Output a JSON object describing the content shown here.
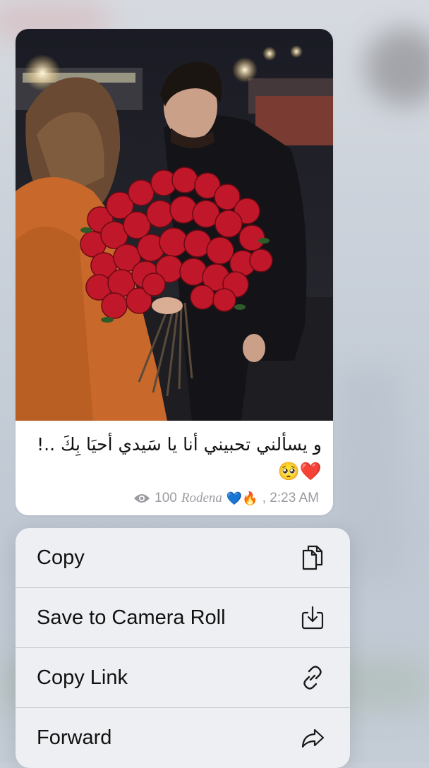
{
  "message": {
    "caption": "و يسألني تحبيني أنا يا سَيدي أحيَا بِكَ ..! ❤️🥺",
    "views": "100",
    "author": "Rodena",
    "author_emoji": "💙🔥",
    "time": ", 2:23 AM",
    "view_icon": "eye-icon",
    "photo_description_icon": "photo"
  },
  "menu": {
    "items": [
      {
        "label": "Copy",
        "icon": "copy-icon"
      },
      {
        "label": "Save to Camera Roll",
        "icon": "save-download-icon"
      },
      {
        "label": "Copy Link",
        "icon": "link-icon"
      },
      {
        "label": "Forward",
        "icon": "forward-arrow-icon"
      }
    ]
  },
  "colors": {
    "menu_background": "#edeff2",
    "bubble_background": "#ffffff",
    "meta_text": "#9a9ca0",
    "rose_red": "#c0182a"
  }
}
